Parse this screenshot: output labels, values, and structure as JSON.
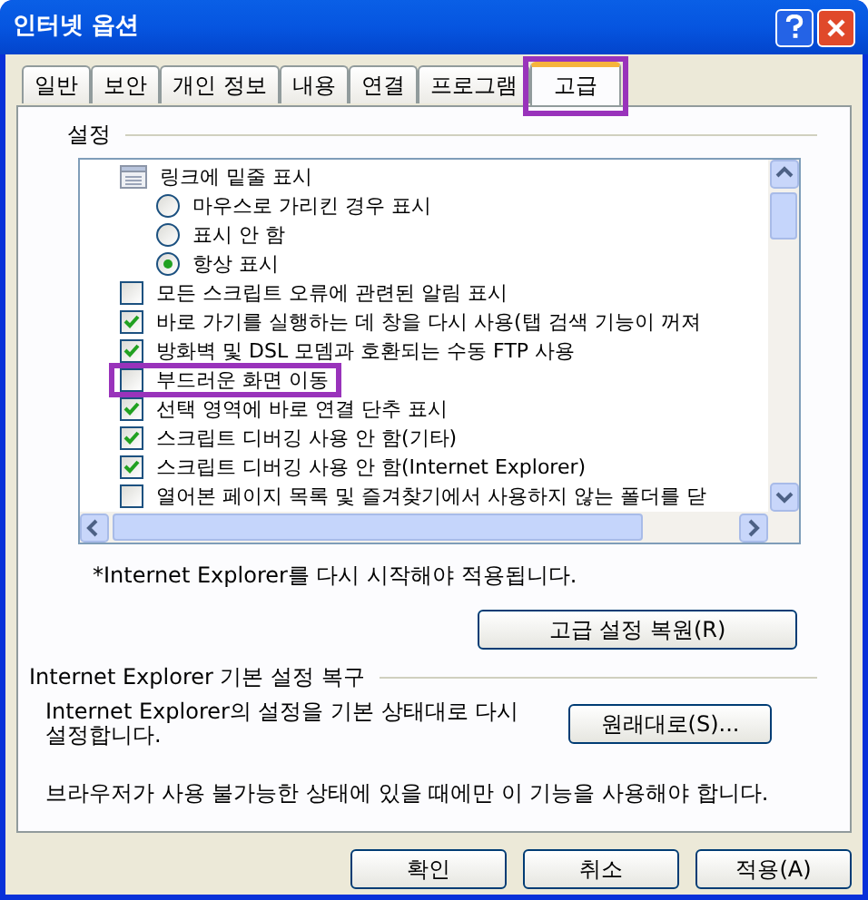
{
  "window": {
    "title": "인터넷 옵션"
  },
  "tabs": [
    {
      "label": "일반",
      "selected": false,
      "highlighted": false
    },
    {
      "label": "보안",
      "selected": false,
      "highlighted": false
    },
    {
      "label": "개인 정보",
      "selected": false,
      "highlighted": false
    },
    {
      "label": "내용",
      "selected": false,
      "highlighted": false
    },
    {
      "label": "연결",
      "selected": false,
      "highlighted": false
    },
    {
      "label": "프로그램",
      "selected": false,
      "highlighted": false
    },
    {
      "label": "고급",
      "selected": true,
      "highlighted": true
    }
  ],
  "settings": {
    "title": "설정",
    "items": [
      {
        "kind": "group",
        "label": "링크에 밑줄 표시",
        "highlighted": false,
        "children": [
          {
            "kind": "radio",
            "label": "마우스로 가리킨 경우 표시",
            "selected": false,
            "highlighted": false
          },
          {
            "kind": "radio",
            "label": "표시 안 함",
            "selected": false,
            "highlighted": false
          },
          {
            "kind": "radio",
            "label": "항상 표시",
            "selected": true,
            "highlighted": false
          }
        ]
      },
      {
        "kind": "checkbox",
        "label": "모든 스크립트 오류에 관련된 알림 표시",
        "checked": false,
        "highlighted": false
      },
      {
        "kind": "checkbox",
        "label": "바로 가기를 실행하는 데 창을 다시 사용(탭 검색 기능이 꺼져",
        "checked": true,
        "highlighted": false
      },
      {
        "kind": "checkbox",
        "label": "방화벽 및 DSL 모뎀과 호환되는 수동 FTP 사용",
        "checked": true,
        "highlighted": false
      },
      {
        "kind": "checkbox",
        "label": "부드러운 화면 이동",
        "checked": false,
        "highlighted": true
      },
      {
        "kind": "checkbox",
        "label": "선택 영역에 바로 연결 단추 표시",
        "checked": true,
        "highlighted": false
      },
      {
        "kind": "checkbox",
        "label": "스크립트 디버깅 사용 안 함(기타)",
        "checked": true,
        "highlighted": false
      },
      {
        "kind": "checkbox",
        "label": "스크립트 디버깅 사용 안 함(Internet Explorer)",
        "checked": true,
        "highlighted": false
      },
      {
        "kind": "checkbox",
        "label": "열어본 페이지 목록 및 즐겨찾기에서 사용하지 않는 폴더를 닫",
        "checked": false,
        "highlighted": false
      }
    ],
    "note": "*Internet Explorer를 다시 시작해야 적용됩니다.",
    "restore_button": "고급 설정 복원(R)"
  },
  "reset": {
    "title": "Internet Explorer 기본 설정 복구",
    "description": "Internet Explorer의 설정을 기본 상태대로 다시 설정합니다.",
    "button": "원래대로(S)...",
    "warning": "브라우저가 사용 불가능한 상태에 있을 때에만 이 기능을 사용해야 합니다."
  },
  "buttons": [
    "확인",
    "취소",
    "적용(A)"
  ]
}
